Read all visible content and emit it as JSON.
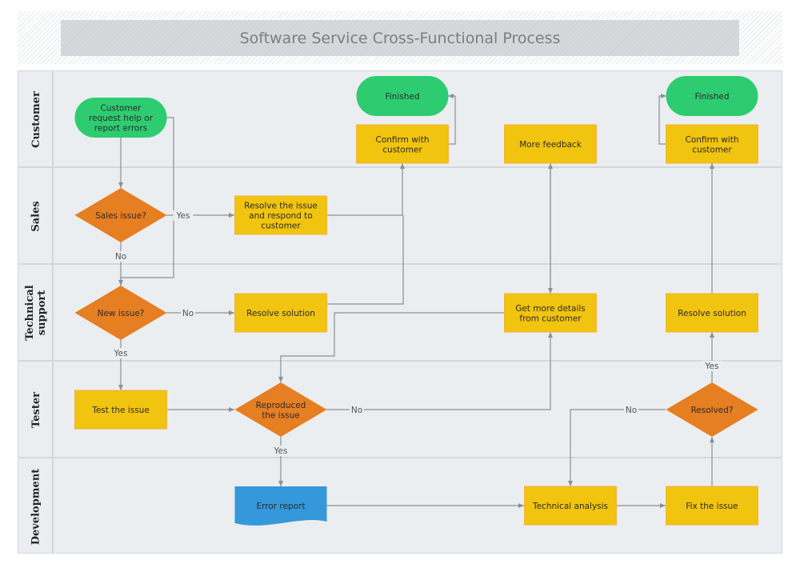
{
  "title": "Software Service Cross-Functional Process",
  "colors": {
    "terminal": "#2ecc71",
    "process": "#f1c40f",
    "decision": "#e67e22",
    "document": "#3498db",
    "connector": "#8c8f93"
  },
  "lanes": [
    {
      "id": "customer",
      "label": "Customer"
    },
    {
      "id": "sales",
      "label": "Sales"
    },
    {
      "id": "technical-support",
      "label": "Technical\nsupport"
    },
    {
      "id": "tester",
      "label": "Tester"
    },
    {
      "id": "development",
      "label": "Development"
    }
  ],
  "nodes": {
    "customer_request": {
      "type": "terminal",
      "lines": [
        "Customer",
        "request help or",
        "report errors"
      ]
    },
    "finished_1": {
      "type": "terminal",
      "lines": [
        "Finished"
      ]
    },
    "confirm_1": {
      "type": "process",
      "lines": [
        "Confirm with",
        "customer"
      ]
    },
    "more_feedback": {
      "type": "process",
      "lines": [
        "More feedback"
      ]
    },
    "finished_2": {
      "type": "terminal",
      "lines": [
        "Finished"
      ]
    },
    "confirm_2": {
      "type": "process",
      "lines": [
        "Confirm with",
        "customer"
      ]
    },
    "sales_issue": {
      "type": "decision",
      "lines": [
        "Sales issue?"
      ]
    },
    "resolve_respond": {
      "type": "process",
      "lines": [
        "Resolve the issue",
        "and respond to",
        "customer"
      ]
    },
    "new_issue": {
      "type": "decision",
      "lines": [
        "New issue?"
      ]
    },
    "resolve_solution_1": {
      "type": "process",
      "lines": [
        "Resolve solution"
      ]
    },
    "get_details": {
      "type": "process",
      "lines": [
        "Get more details",
        "from customer"
      ]
    },
    "resolve_solution_2": {
      "type": "process",
      "lines": [
        "Resolve solution"
      ]
    },
    "test_issue": {
      "type": "process",
      "lines": [
        "Test the issue"
      ]
    },
    "reproduced": {
      "type": "decision",
      "lines": [
        "Reproduced",
        "the issue"
      ]
    },
    "resolved": {
      "type": "decision",
      "lines": [
        "Resolved?"
      ]
    },
    "error_report": {
      "type": "document",
      "lines": [
        "Error report"
      ]
    },
    "technical_analysis": {
      "type": "process",
      "lines": [
        "Technical analysis"
      ]
    },
    "fix_issue": {
      "type": "process",
      "lines": [
        "Fix the issue"
      ]
    }
  },
  "edge_labels": {
    "sales_yes": "Yes",
    "sales_no": "No",
    "new_no": "No",
    "new_yes": "Yes",
    "repro_no": "No",
    "repro_yes": "Yes",
    "resolved_no": "No",
    "resolved_yes": "Yes"
  }
}
